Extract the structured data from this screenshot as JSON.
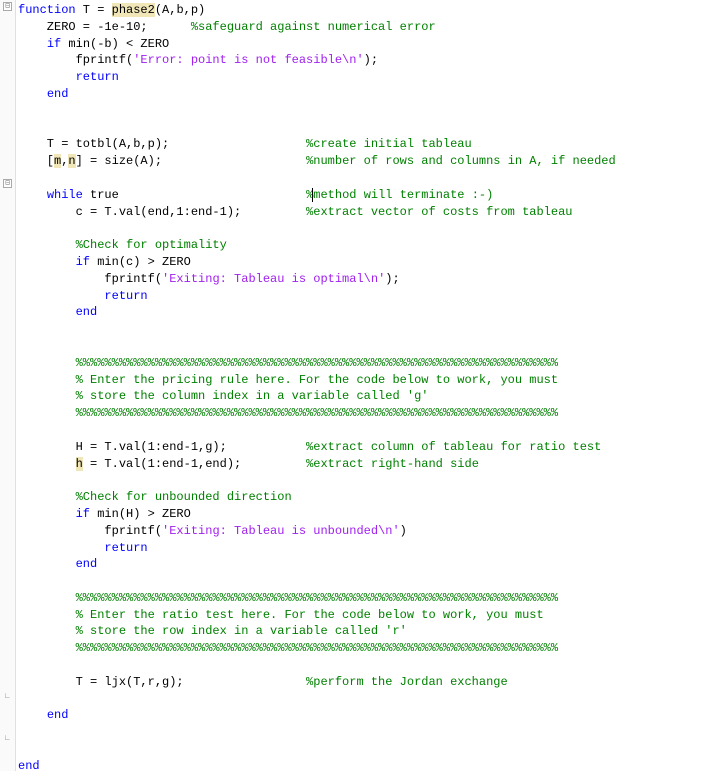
{
  "fold_glyphs": {
    "open": "⊟",
    "close": "∟"
  },
  "code_lines": [
    {
      "tokens": [
        {
          "t": "kw",
          "v": "function"
        },
        {
          "t": "p",
          "v": " T = "
        },
        {
          "t": "hl",
          "v": "phase2"
        },
        {
          "t": "p",
          "v": "(A,b,p)"
        }
      ]
    },
    {
      "tokens": [
        {
          "t": "p",
          "v": "    ZERO = -1e-10;      "
        },
        {
          "t": "cmt",
          "v": "%safeguard against numerical error"
        }
      ]
    },
    {
      "tokens": [
        {
          "t": "p",
          "v": "    "
        },
        {
          "t": "kw",
          "v": "if"
        },
        {
          "t": "p",
          "v": " min(-b) < ZERO"
        }
      ]
    },
    {
      "tokens": [
        {
          "t": "p",
          "v": "        fprintf("
        },
        {
          "t": "str",
          "v": "'Error: point is not feasible\\n'"
        },
        {
          "t": "p",
          "v": ");"
        }
      ]
    },
    {
      "tokens": [
        {
          "t": "p",
          "v": "        "
        },
        {
          "t": "kw",
          "v": "return"
        }
      ]
    },
    {
      "tokens": [
        {
          "t": "p",
          "v": "    "
        },
        {
          "t": "kw",
          "v": "end"
        }
      ]
    },
    {
      "tokens": []
    },
    {
      "tokens": []
    },
    {
      "tokens": [
        {
          "t": "p",
          "v": "    T = totbl(A,b,p);                   "
        },
        {
          "t": "cmt",
          "v": "%create initial tableau"
        }
      ]
    },
    {
      "tokens": [
        {
          "t": "p",
          "v": "    ["
        },
        {
          "t": "hl",
          "v": "m"
        },
        {
          "t": "p",
          "v": ","
        },
        {
          "t": "hl",
          "v": "n"
        },
        {
          "t": "p",
          "v": "] = size(A);                    "
        },
        {
          "t": "cmt",
          "v": "%number of rows and columns in A, if needed"
        }
      ]
    },
    {
      "tokens": []
    },
    {
      "tokens": [
        {
          "t": "p",
          "v": "    "
        },
        {
          "t": "kw",
          "v": "while"
        },
        {
          "t": "p",
          "v": " true                          "
        },
        {
          "t": "cmt",
          "v": "%"
        },
        {
          "t": "cursor",
          "v": ""
        },
        {
          "t": "cmt",
          "v": "method will terminate :-)"
        }
      ]
    },
    {
      "tokens": [
        {
          "t": "p",
          "v": "        c = T.val(end,1:end-1);         "
        },
        {
          "t": "cmt",
          "v": "%extract vector of costs from tableau"
        }
      ]
    },
    {
      "tokens": []
    },
    {
      "tokens": [
        {
          "t": "p",
          "v": "        "
        },
        {
          "t": "cmt",
          "v": "%Check for optimality"
        }
      ]
    },
    {
      "tokens": [
        {
          "t": "p",
          "v": "        "
        },
        {
          "t": "kw",
          "v": "if"
        },
        {
          "t": "p",
          "v": " min(c) > ZERO"
        }
      ]
    },
    {
      "tokens": [
        {
          "t": "p",
          "v": "            fprintf("
        },
        {
          "t": "str",
          "v": "'Exiting: Tableau is optimal\\n'"
        },
        {
          "t": "p",
          "v": ");"
        }
      ]
    },
    {
      "tokens": [
        {
          "t": "p",
          "v": "            "
        },
        {
          "t": "kw",
          "v": "return"
        }
      ]
    },
    {
      "tokens": [
        {
          "t": "p",
          "v": "        "
        },
        {
          "t": "kw",
          "v": "end"
        }
      ]
    },
    {
      "tokens": []
    },
    {
      "tokens": []
    },
    {
      "tokens": [
        {
          "t": "p",
          "v": "        "
        },
        {
          "t": "cmt",
          "v": "%%%%%%%%%%%%%%%%%%%%%%%%%%%%%%%%%%%%%%%%%%%%%%%%%%%%%%%%%%%%%%%%%%%"
        }
      ]
    },
    {
      "tokens": [
        {
          "t": "p",
          "v": "        "
        },
        {
          "t": "cmt",
          "v": "% Enter the pricing rule here. For the code below to work, you must"
        }
      ]
    },
    {
      "tokens": [
        {
          "t": "p",
          "v": "        "
        },
        {
          "t": "cmt",
          "v": "% store the column index in a variable called 'g'"
        }
      ]
    },
    {
      "tokens": [
        {
          "t": "p",
          "v": "        "
        },
        {
          "t": "cmt",
          "v": "%%%%%%%%%%%%%%%%%%%%%%%%%%%%%%%%%%%%%%%%%%%%%%%%%%%%%%%%%%%%%%%%%%%"
        }
      ]
    },
    {
      "tokens": []
    },
    {
      "tokens": [
        {
          "t": "p",
          "v": "        H = T.val(1:end-1,g);           "
        },
        {
          "t": "cmt",
          "v": "%extract column of tableau for ratio test"
        }
      ]
    },
    {
      "tokens": [
        {
          "t": "p",
          "v": "        "
        },
        {
          "t": "hl",
          "v": "h"
        },
        {
          "t": "p",
          "v": " = T.val(1:end-1,end);         "
        },
        {
          "t": "cmt",
          "v": "%extract right-hand side"
        }
      ]
    },
    {
      "tokens": []
    },
    {
      "tokens": [
        {
          "t": "p",
          "v": "        "
        },
        {
          "t": "cmt",
          "v": "%Check for unbounded direction"
        }
      ]
    },
    {
      "tokens": [
        {
          "t": "p",
          "v": "        "
        },
        {
          "t": "kw",
          "v": "if"
        },
        {
          "t": "p",
          "v": " min(H) > ZERO"
        }
      ]
    },
    {
      "tokens": [
        {
          "t": "p",
          "v": "            fprintf("
        },
        {
          "t": "str",
          "v": "'Exiting: Tableau is unbounded\\n'"
        },
        {
          "t": "p",
          "v": ")"
        }
      ]
    },
    {
      "tokens": [
        {
          "t": "p",
          "v": "            "
        },
        {
          "t": "kw",
          "v": "return"
        }
      ]
    },
    {
      "tokens": [
        {
          "t": "p",
          "v": "        "
        },
        {
          "t": "kw",
          "v": "end"
        }
      ]
    },
    {
      "tokens": []
    },
    {
      "tokens": [
        {
          "t": "p",
          "v": "        "
        },
        {
          "t": "cmt",
          "v": "%%%%%%%%%%%%%%%%%%%%%%%%%%%%%%%%%%%%%%%%%%%%%%%%%%%%%%%%%%%%%%%%%%%"
        }
      ]
    },
    {
      "tokens": [
        {
          "t": "p",
          "v": "        "
        },
        {
          "t": "cmt",
          "v": "% Enter the ratio test here. For the code below to work, you must"
        }
      ]
    },
    {
      "tokens": [
        {
          "t": "p",
          "v": "        "
        },
        {
          "t": "cmt",
          "v": "% store the row index in a variable called 'r'"
        }
      ]
    },
    {
      "tokens": [
        {
          "t": "p",
          "v": "        "
        },
        {
          "t": "cmt",
          "v": "%%%%%%%%%%%%%%%%%%%%%%%%%%%%%%%%%%%%%%%%%%%%%%%%%%%%%%%%%%%%%%%%%%%"
        }
      ]
    },
    {
      "tokens": []
    },
    {
      "tokens": [
        {
          "t": "p",
          "v": "        T = ljx(T,r,g);                 "
        },
        {
          "t": "cmt",
          "v": "%perform the Jordan exchange"
        }
      ]
    },
    {
      "tokens": []
    },
    {
      "tokens": [
        {
          "t": "p",
          "v": "    "
        },
        {
          "t": "kw",
          "v": "end"
        }
      ]
    },
    {
      "tokens": []
    },
    {
      "tokens": []
    },
    {
      "tokens": [
        {
          "t": "kw",
          "v": "end"
        }
      ]
    }
  ]
}
